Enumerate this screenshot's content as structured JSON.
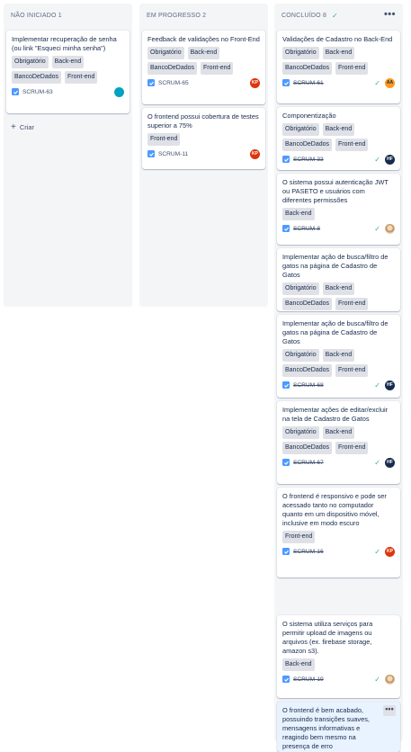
{
  "columns": [
    {
      "header": "NÃO INICIADO 1",
      "create_label": "Criar",
      "cards": [
        {
          "title": "Implementar recuperação de senha (ou link \"Esqueci minha senha\")",
          "labels": [
            "Obrigatório",
            "Back-end",
            "BancoDeDados",
            "Front-end"
          ],
          "key": "SCRUM-63",
          "avatar": "teal-avatar-icon"
        }
      ]
    },
    {
      "header": "EM PROGRESSO 2",
      "cards": [
        {
          "title": "Feedback de validações no Front-End",
          "labels": [
            "Obrigatório",
            "Back-end",
            "BancoDeDados",
            "Front-end"
          ],
          "key": "SCRUM-65",
          "avatar_initials": "KP"
        },
        {
          "title": "O frontend possui cobertura de testes superior a 75%",
          "labels": [
            "Front-end"
          ],
          "key": "SCRUM-11",
          "avatar_initials": "KP"
        }
      ]
    },
    {
      "header": "CONCLUÍDO 8",
      "more_label": "•••",
      "cards": [
        {
          "title": "Validações de Cadastro no Back-End",
          "labels": [
            "Obrigatório",
            "Back-end",
            "BancoDeDados",
            "Front-end"
          ],
          "key": "SCRUM-61",
          "avatar_initials": "AA"
        },
        {
          "title": "Componentização",
          "labels": [
            "Obrigatório",
            "Back-end",
            "BancoDeDados",
            "Front-end"
          ],
          "key": "SCRUM-33",
          "avatar_initials": "HF"
        },
        {
          "title": "O sistema possui autenticação JWT ou PASETO e usuários com diferentes permissões",
          "labels": [
            "Back-end"
          ],
          "key": "SCRUM-8",
          "avatar": "photo-avatar-icon"
        },
        {
          "title": "Implementar ação de busca/filtro de gatos na página de Cadastro de Gatos",
          "labels": [
            "Obrigatório",
            "Back-end",
            "BancoDeDados",
            "Front-end"
          ],
          "key": ""
        },
        {
          "title": "Implementar ação de busca/filtro de gatos na página de Cadastro de Gatos",
          "labels": [
            "Obrigatório",
            "Back-end",
            "BancoDeDados",
            "Front-end"
          ],
          "key": "SCRUM-68",
          "avatar_initials": "HF"
        },
        {
          "title": "Implementar ações de editar/excluir na tela de Cadastro de Gatos",
          "labels": [
            "Obrigatório",
            "Back-end",
            "BancoDeDados",
            "Front-end"
          ],
          "key": "SCRUM-67",
          "avatar_initials": "HF"
        },
        {
          "title": "O frontend é responsivo e pode ser acessado tanto no computador quanto em um dispositivo móvel, inclusive em modo escuro",
          "labels": [
            "Front-end"
          ],
          "key": "SCRUM-16",
          "avatar_initials": "KP"
        },
        {
          "title": "O sistema utiliza serviços para permitir upload de imagens ou arquivos (ex. firebase storage, amazon s3).",
          "labels": [
            "Back-end"
          ],
          "key": "SCRUM-19",
          "avatar": "photo-avatar-icon"
        },
        {
          "title": "O frontend é bem acabado, possuindo transições suaves, mensagens informativas e reagindo bem mesmo na presença de erro",
          "labels": [],
          "key": "",
          "more_label": "•••"
        }
      ]
    }
  ],
  "colors": {
    "accent": "#4c9aff",
    "done": "#36b37e",
    "kp": "#de350b",
    "aa": "#ff991f",
    "hf": "#172b4d",
    "teal": "#00a3bf"
  }
}
